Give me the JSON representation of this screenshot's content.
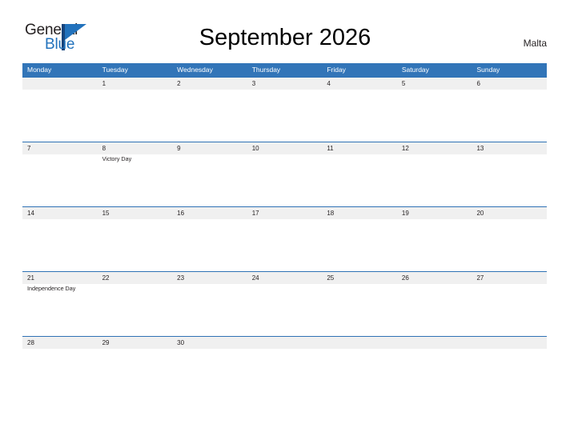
{
  "brand": {
    "name_part1": "General",
    "name_part2": "Blue",
    "accent_color": "#2272bc",
    "bar_color": "#16447c",
    "flag_icon": "flag-triangle-icon"
  },
  "header": {
    "title": "September 2026",
    "country": "Malta"
  },
  "calendar": {
    "header_bg": "#3275b8",
    "band_bg": "#f0f0f0",
    "line_color": "#2f72b5",
    "weekdays": [
      "Monday",
      "Tuesday",
      "Wednesday",
      "Thursday",
      "Friday",
      "Saturday",
      "Sunday"
    ],
    "weeks": [
      {
        "days": [
          {
            "num": "",
            "event": ""
          },
          {
            "num": "1",
            "event": ""
          },
          {
            "num": "2",
            "event": ""
          },
          {
            "num": "3",
            "event": ""
          },
          {
            "num": "4",
            "event": ""
          },
          {
            "num": "5",
            "event": ""
          },
          {
            "num": "6",
            "event": ""
          }
        ]
      },
      {
        "days": [
          {
            "num": "7",
            "event": ""
          },
          {
            "num": "8",
            "event": "Victory Day"
          },
          {
            "num": "9",
            "event": ""
          },
          {
            "num": "10",
            "event": ""
          },
          {
            "num": "11",
            "event": ""
          },
          {
            "num": "12",
            "event": ""
          },
          {
            "num": "13",
            "event": ""
          }
        ]
      },
      {
        "days": [
          {
            "num": "14",
            "event": ""
          },
          {
            "num": "15",
            "event": ""
          },
          {
            "num": "16",
            "event": ""
          },
          {
            "num": "17",
            "event": ""
          },
          {
            "num": "18",
            "event": ""
          },
          {
            "num": "19",
            "event": ""
          },
          {
            "num": "20",
            "event": ""
          }
        ]
      },
      {
        "days": [
          {
            "num": "21",
            "event": "Independence Day"
          },
          {
            "num": "22",
            "event": ""
          },
          {
            "num": "23",
            "event": ""
          },
          {
            "num": "24",
            "event": ""
          },
          {
            "num": "25",
            "event": ""
          },
          {
            "num": "26",
            "event": ""
          },
          {
            "num": "27",
            "event": ""
          }
        ]
      },
      {
        "days": [
          {
            "num": "28",
            "event": ""
          },
          {
            "num": "29",
            "event": ""
          },
          {
            "num": "30",
            "event": ""
          },
          {
            "num": "",
            "event": ""
          },
          {
            "num": "",
            "event": ""
          },
          {
            "num": "",
            "event": ""
          },
          {
            "num": "",
            "event": ""
          }
        ]
      }
    ]
  }
}
